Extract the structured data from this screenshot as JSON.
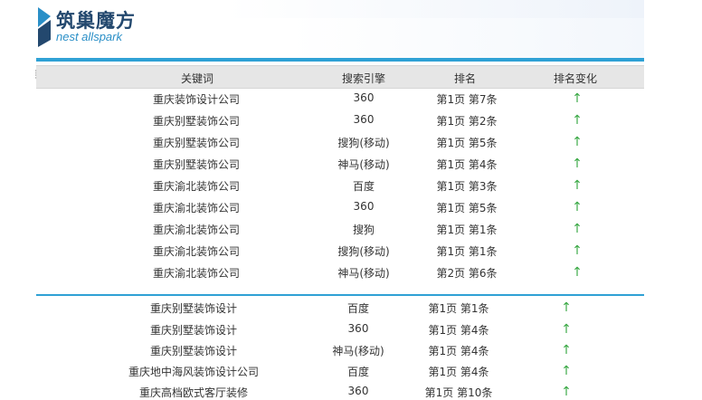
{
  "brand": {
    "name_cn": "筑巢魔方",
    "name_en": "nest allspark"
  },
  "table": {
    "headers": {
      "keyword": "关键词",
      "engine": "搜索引擎",
      "rank": "排名",
      "change": "排名变化"
    },
    "group1": [
      {
        "keyword": "重庆装饰设计公司",
        "engine": "360",
        "rank": "第1页 第7条",
        "change": "↑"
      },
      {
        "keyword": "重庆别墅装饰公司",
        "engine": "360",
        "rank": "第1页 第2条",
        "change": "↑"
      },
      {
        "keyword": "重庆别墅装饰公司",
        "engine": "搜狗(移动)",
        "rank": "第1页 第5条",
        "change": "↑"
      },
      {
        "keyword": "重庆别墅装饰公司",
        "engine": "神马(移动)",
        "rank": "第1页 第4条",
        "change": "↑"
      },
      {
        "keyword": "重庆渝北装饰公司",
        "engine": "百度",
        "rank": "第1页 第3条",
        "change": "↑"
      },
      {
        "keyword": "重庆渝北装饰公司",
        "engine": "360",
        "rank": "第1页 第5条",
        "change": "↑"
      },
      {
        "keyword": "重庆渝北装饰公司",
        "engine": "搜狗",
        "rank": "第1页 第1条",
        "change": "↑"
      },
      {
        "keyword": "重庆渝北装饰公司",
        "engine": "搜狗(移动)",
        "rank": "第1页 第1条",
        "change": "↑"
      },
      {
        "keyword": "重庆渝北装饰公司",
        "engine": "神马(移动)",
        "rank": "第2页 第6条",
        "change": "↑"
      }
    ],
    "group2": [
      {
        "keyword": "重庆别墅装饰设计",
        "engine": "百度",
        "rank": "第1页 第1条",
        "change": "↑"
      },
      {
        "keyword": "重庆别墅装饰设计",
        "engine": "360",
        "rank": "第1页 第4条",
        "change": "↑"
      },
      {
        "keyword": "重庆别墅装饰设计",
        "engine": "神马(移动)",
        "rank": "第1页 第4条",
        "change": "↑"
      },
      {
        "keyword": "重庆地中海风装饰设计公司",
        "engine": "百度",
        "rank": "第1页 第4条",
        "change": "↑"
      },
      {
        "keyword": "重庆高档欧式客厅装修",
        "engine": "360",
        "rank": "第1页 第10条",
        "change": "↑"
      }
    ]
  },
  "colors": {
    "accent": "#2fa1d5",
    "arrow_up": "#39a844",
    "header_bg": "#e6e6e6"
  }
}
